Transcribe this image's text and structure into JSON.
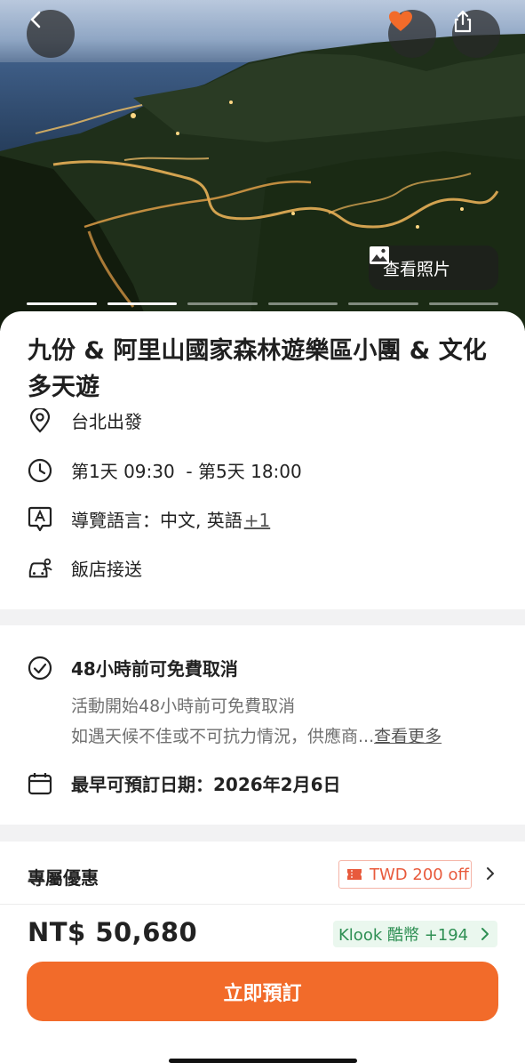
{
  "header": {
    "photos_label": "查看照片",
    "carousel_total": 6,
    "carousel_current": 1
  },
  "activity": {
    "title": "九份 & 阿里山國家森林遊樂區小團 & 文化多天遊",
    "departure": "台北出發",
    "schedule": "第1天 09:30  - 第5天 18:00",
    "language_label": "導覽語言：中文, 英語",
    "language_more": "+1",
    "pickup": "飯店接送"
  },
  "policy": {
    "cancel_title": "48小時前可免費取消",
    "cancel_detail": "活動開始48小時前可免費取消",
    "weather_note": "如遇天候不佳或不可抗力情況，供應商...",
    "see_more": "查看更多",
    "earliest_date": "最早可預訂日期：2026年2月6日"
  },
  "promo": {
    "label": "專屬優惠",
    "tag": "TWD 200 off"
  },
  "footer": {
    "price": "NT$ 50,680",
    "coins": "Klook 酷幣 +194",
    "book_button": "立即預訂"
  },
  "colors": {
    "accent": "#f26b2a",
    "favorite": "#f26b2a",
    "coins_text": "#2e8f53",
    "promo_text": "#e85a3c"
  }
}
